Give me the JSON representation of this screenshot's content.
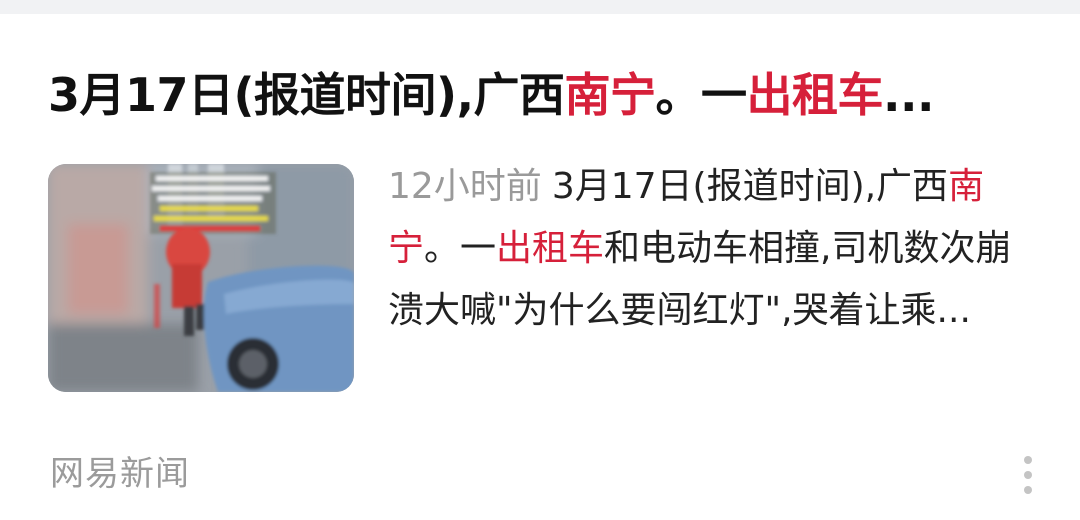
{
  "headline": {
    "part1": "3月17日(报道时间),广西",
    "highlight1": "南宁",
    "part2": "。一",
    "highlight2": "出租车",
    "ellipsis": "..."
  },
  "summary": {
    "time": "12小时前",
    "part1": "3月17日(报道时间),广西",
    "highlight1": "南宁",
    "part2": "。一",
    "highlight2": "出租车",
    "part3": "和电动车相撞,司机数次崩溃大喊\"为什么要闯红灯\",哭着让乘..."
  },
  "source": "网易新闻",
  "icons": {
    "more": "more-vertical-icon"
  },
  "colors": {
    "highlight": "#d6203a",
    "meta_gray": "#9a9a9a",
    "text": "#111111"
  }
}
